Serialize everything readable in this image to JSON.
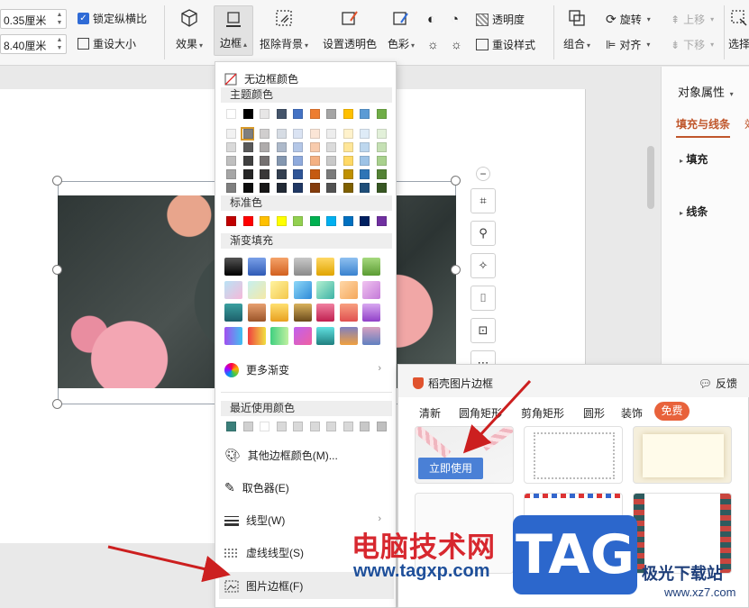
{
  "ribbon": {
    "height_value": "0.35厘米",
    "width_value": "8.40厘米",
    "lock_ratio_label": "锁定纵横比",
    "reset_size_label": "重设大小",
    "effects_label": "效果",
    "border_label": "边框",
    "remove_bg_label": "抠除背景",
    "set_transparent_label": "设置透明色",
    "color_label": "色彩",
    "transparency_label": "透明度",
    "reset_style_label": "重设样式",
    "combine_label": "组合",
    "rotate_label": "旋转",
    "align_label": "对齐",
    "move_up_label": "上移",
    "move_down_label": "下移",
    "select_label": "选择"
  },
  "right_panel": {
    "title": "对象属性",
    "tab_fill_line": "填充与线条",
    "tab_effect": "效",
    "section_fill": "填充",
    "section_line": "线条"
  },
  "border_menu": {
    "no_border_color": "无边框颜色",
    "theme_colors": "主题颜色",
    "standard_colors": "标准色",
    "gradient_fill": "渐变填充",
    "more_gradients": "更多渐变",
    "recent_colors": "最近使用颜色",
    "other_border_colors": "其他边框颜色(M)...",
    "eyedropper": "取色器(E)",
    "line_style": "线型(W)",
    "dash_style": "虚线线型(S)",
    "picture_border": "图片边框(F)",
    "theme_top_row": [
      "#ffffff",
      "#000000",
      "#e7e6e6",
      "#44546a",
      "#4472c4",
      "#ed7d31",
      "#a5a5a5",
      "#ffc000",
      "#5b9bd5",
      "#70ad47"
    ],
    "theme_shades": [
      [
        "#f2f2f2",
        "#7f7f7f",
        "#d0cece",
        "#d6dce4",
        "#dae3f3",
        "#fbe5d6",
        "#ededed",
        "#fff2cc",
        "#deebf7",
        "#e2f0d9"
      ],
      [
        "#d9d9d9",
        "#595959",
        "#aeabab",
        "#adb9ca",
        "#b4c7e7",
        "#f8cbad",
        "#dbdbdb",
        "#ffe699",
        "#bdd7ee",
        "#c5e0b4"
      ],
      [
        "#bfbfbf",
        "#404040",
        "#757171",
        "#8497b0",
        "#8faadc",
        "#f4b183",
        "#c9c9c9",
        "#ffd966",
        "#9dc3e6",
        "#a9d18e"
      ],
      [
        "#a6a6a6",
        "#262626",
        "#3a3838",
        "#333f50",
        "#2f5597",
        "#c55a11",
        "#7b7b7b",
        "#bf9000",
        "#2e75b6",
        "#548235"
      ],
      [
        "#7f7f7f",
        "#0d0d0d",
        "#171616",
        "#222a35",
        "#203864",
        "#843c0c",
        "#525252",
        "#7f6000",
        "#1f4e79",
        "#385723"
      ]
    ],
    "standard": [
      "#c00000",
      "#ff0000",
      "#ffc000",
      "#ffff00",
      "#92d050",
      "#00b050",
      "#00b0f0",
      "#0070c0",
      "#002060",
      "#7030a0"
    ],
    "gradients": [
      [
        "linear-gradient(#555,#000)",
        "linear-gradient(#7aa0e8,#2f5ab5)",
        "linear-gradient(#f5a36a,#d2601f)",
        "linear-gradient(#c8c8c8,#8a8a8a)",
        "linear-gradient(#ffd866,#e0a400)",
        "linear-gradient(#8fc0f0,#3a82cf)",
        "linear-gradient(#a6d97e,#5b9b33)"
      ],
      [
        "linear-gradient(135deg,#b9e2f5,#f5b9d9)",
        "linear-gradient(135deg,#c6f0f0,#f5e9a6)",
        "linear-gradient(135deg,#fff3a0,#f4c84c)",
        "linear-gradient(135deg,#8ed8f8,#2e8bd8)",
        "linear-gradient(135deg,#b3f0d0,#3db3a6)",
        "linear-gradient(135deg,#ffd7a8,#f5a85c)",
        "linear-gradient(135deg,#f0c4f0,#c47ad8)"
      ],
      [
        "linear-gradient(#3aa0a0,#1d5f6a)",
        "linear-gradient(#e8a070,#9a5428)",
        "linear-gradient(#ffe070,#e8a020)",
        "linear-gradient(#d9b25c,#6a4a1a)",
        "linear-gradient(#f080a0,#c02050)",
        "linear-gradient(#f8a080,#e05050)",
        "linear-gradient(#d8a8f0,#9040c8)"
      ],
      [
        "linear-gradient(90deg,#a050f0,#40c0f0)",
        "linear-gradient(90deg,#f04040,#f0e040)",
        "linear-gradient(90deg,#40d080,#c0f0a0)",
        "linear-gradient(135deg,#c060f0,#f060a0)",
        "linear-gradient(#60e0e0,#208080)",
        "linear-gradient(#8080c0,#f0a040)",
        "linear-gradient(#d8a0c0,#6080c0)"
      ]
    ],
    "recent": [
      "#3b7f7a",
      "#d0d0d0",
      "#ffffff",
      "#d9d9d9",
      "#d9d9d9",
      "#d9d9d9",
      "#d9d9d9",
      "#d9d9d9",
      "#c8c8c8",
      "#bfbfbf"
    ]
  },
  "flyout": {
    "title": "稻壳图片边框",
    "feedback": "反馈",
    "tabs": [
      "清新",
      "圆角矩形",
      "剪角矩形",
      "圆形",
      "装饰"
    ],
    "free_tab": "免费",
    "use_now": "立即使用"
  },
  "watermark": {
    "cn_text": "电脑技术网",
    "url": "www.tagxp.com",
    "logo": "TAG",
    "site_name": "极光下载站",
    "site_url": "www.xz7.com"
  }
}
